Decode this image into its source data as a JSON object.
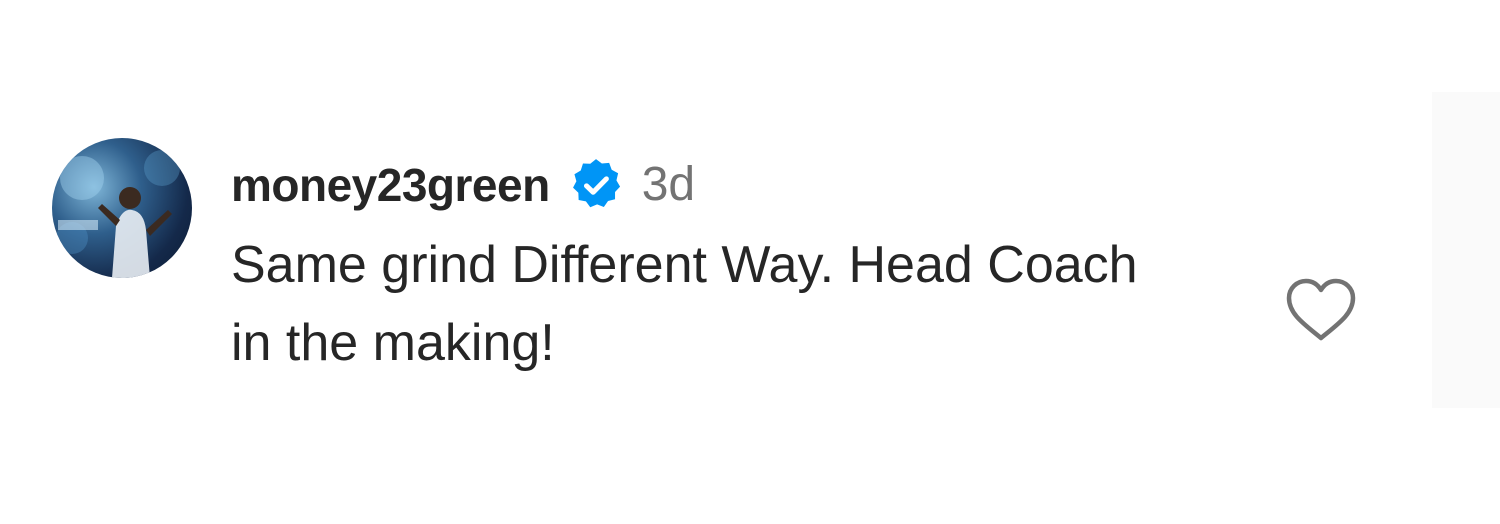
{
  "comment": {
    "username": "money23green",
    "verified": true,
    "timestamp": "3d",
    "text": "Same grind Different Way. Head Coach in the making!"
  },
  "icons": {
    "verified_badge": "verified-badge-icon",
    "like": "heart-outline-icon"
  },
  "colors": {
    "text_primary": "#262626",
    "text_secondary": "#737373",
    "verified_blue": "#0095f6"
  }
}
